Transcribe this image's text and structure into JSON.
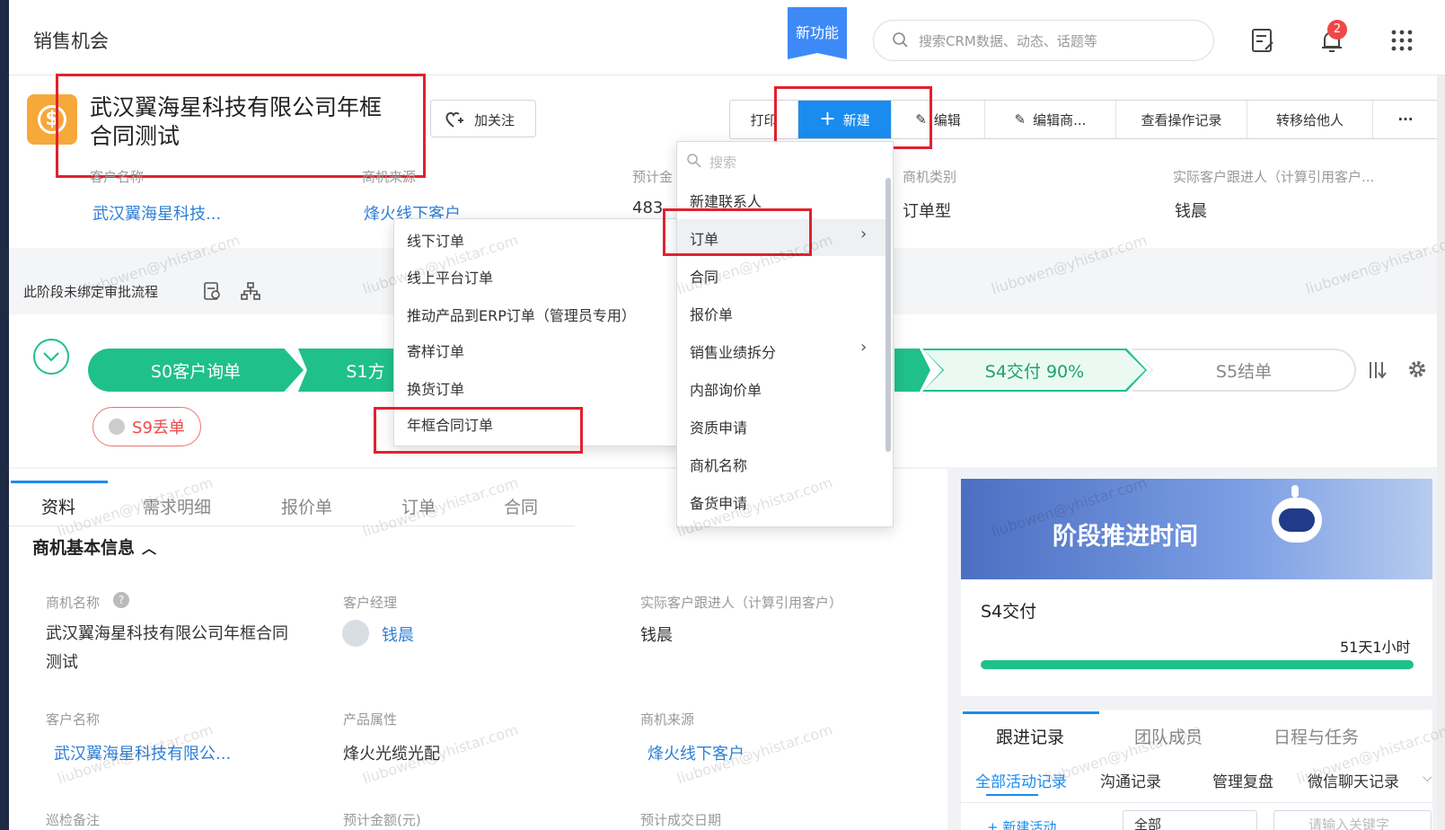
{
  "header": {
    "title": "销售机会",
    "new_feature": "新功能",
    "search_placeholder": "搜索CRM数据、动态、话题等",
    "bell_count": "2"
  },
  "opportunity": {
    "title": "武汉翼海星科技有限公司年框合同测试",
    "follow_label": "加关注"
  },
  "toolbar": {
    "print": "打印",
    "new": "新建",
    "edit": "编辑",
    "edit_biz": "编辑商...",
    "history": "查看操作记录",
    "transfer": "转移给他人",
    "more": "···"
  },
  "summary": {
    "customer_label": "客户名称",
    "customer_value": "武汉翼海星科技...",
    "source_label": "商机来源",
    "source_value": "烽火线下客户",
    "amount_label": "预计金",
    "amount_value": "483",
    "category_label": "商机类别",
    "category_value": "订单型",
    "follower_label": "实际客户跟进人（计算引用客户...",
    "follower_value": "钱晨"
  },
  "approval": {
    "text": "此阶段未绑定审批流程"
  },
  "stages": {
    "s0": "S0客户询单",
    "s1": "S1方",
    "s4": "S4交付 90%",
    "s5": "S5结单",
    "lost": "S9丢单"
  },
  "tabs": [
    "资料",
    "需求明细",
    "报价单",
    "订单",
    "合同"
  ],
  "section": {
    "title": "商机基本信息"
  },
  "fields": [
    {
      "label": "商机名称",
      "value": "武汉翼海星科技有限公司年框合同测试"
    },
    {
      "label": "客户经理",
      "value": "钱晨"
    },
    {
      "label": "实际客户跟进人（计算引用客户）",
      "value": "钱晨"
    },
    {
      "label": "客户名称",
      "value": "武汉翼海星科技有限公..."
    },
    {
      "label": "产品属性",
      "value": "烽火光缆光配"
    },
    {
      "label": "商机来源",
      "value": "烽火线下客户"
    },
    {
      "label": "巡检备注",
      "value": ""
    },
    {
      "label": "预计金额(元)",
      "value": ""
    },
    {
      "label": "预计成交日期",
      "value": ""
    }
  ],
  "stage_time": {
    "banner_title": "阶段推进时间",
    "stage": "S4交付",
    "duration": "51天1小时",
    "progress": 1.0
  },
  "activity": {
    "tabs": [
      "跟进记录",
      "团队成员",
      "日程与任务"
    ],
    "subtabs": [
      "全部活动记录",
      "沟通记录",
      "管理复盘",
      "微信聊天记录"
    ],
    "new_activity": "+ 新建活动",
    "filter": "全部",
    "search_placeholder": "请输入关键字"
  },
  "new_menu": {
    "search_placeholder": "搜索",
    "items": [
      "新建联系人",
      "订单",
      "合同",
      "报价单",
      "销售业绩拆分",
      "内部询价单",
      "资质申请",
      "商机名称",
      "备货申请"
    ]
  },
  "order_submenu": {
    "items": [
      "线下订单",
      "线上平台订单",
      "推动产品到ERP订单（管理员专用）",
      "寄样订单",
      "换货订单",
      "年框合同订单"
    ]
  },
  "watermark": "liubowen@yhistar.com",
  "colors": {
    "primary": "#1a8cf0",
    "stage_green": "#20c08a",
    "lost_red": "#f04a4a",
    "highlight": "#e0222e"
  }
}
